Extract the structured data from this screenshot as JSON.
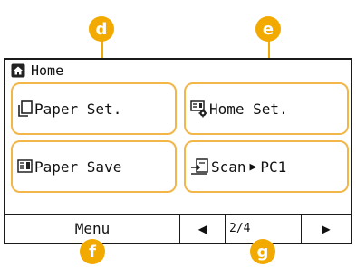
{
  "header": {
    "title": "Home"
  },
  "tiles": [
    {
      "label": "Paper Set.",
      "icon": "paper-stack-icon"
    },
    {
      "label": "Home Set.",
      "icon": "home-settings-icon"
    },
    {
      "label": "Paper Save",
      "icon": "paper-save-icon"
    },
    {
      "label": "Scan",
      "arrow": "▶",
      "target": "PC1",
      "icon": "scan-to-pc-icon"
    }
  ],
  "bottom": {
    "menu_label": "Menu",
    "prev_glyph": "◀",
    "next_glyph": "▶",
    "page_indicator": "2/4"
  },
  "callouts": [
    "d",
    "e",
    "f",
    "g"
  ],
  "colors": {
    "tile_border": "#f2b649",
    "callout": "#f2a900",
    "screen_border": "#1a1a1a"
  }
}
